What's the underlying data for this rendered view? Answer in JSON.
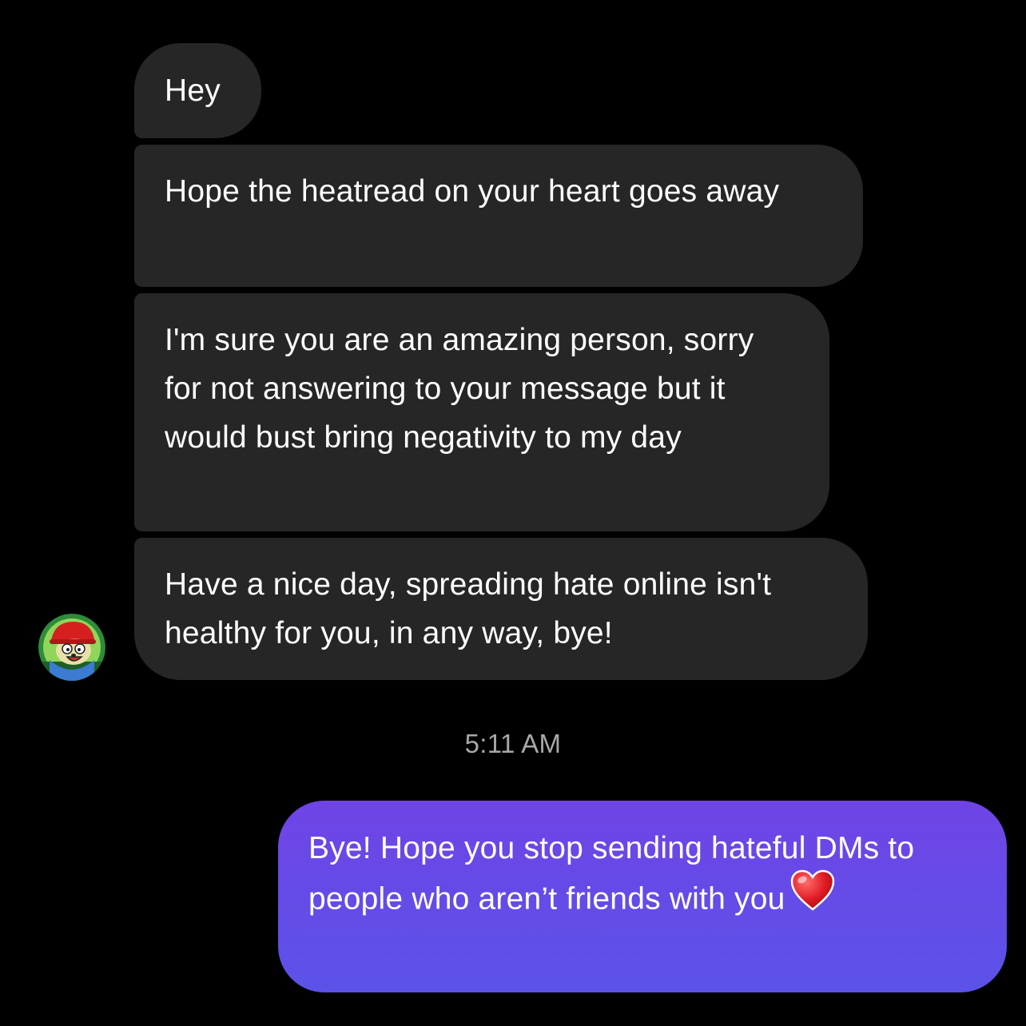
{
  "conversation": {
    "received_messages": [
      "Hey",
      "Hope the heatread on your heart goes away",
      "I'm sure you are an amazing person, sorry for not answering to your message but it would bust bring negativity to my day",
      "Have a nice day, spreading hate online isn't healthy for you, in any way, bye!"
    ],
    "timestamp": "5:11 AM",
    "sent_message": "Bye! Hope you stop sending hateful DMs to people who aren’t friends with you",
    "sent_emoji": "heart-emoji-icon"
  },
  "avatar": {
    "icon": "cartoon-avatar-icon",
    "ring_color": "#2e8b3a"
  },
  "colors": {
    "background": "#000000",
    "received_bubble": "#262626",
    "sent_bubble_top": "#6f44e6",
    "sent_bubble_bottom": "#5b52e8",
    "timestamp_text": "#a8a8a8"
  }
}
